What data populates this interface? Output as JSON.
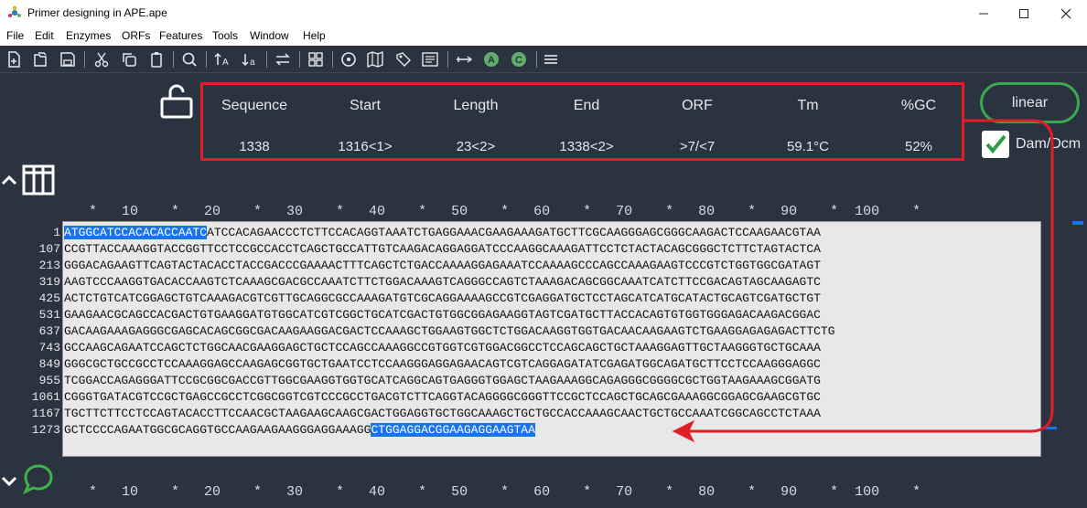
{
  "window": {
    "title": "Primer designing in APE.ape",
    "minimize": "–",
    "maximize": "☐",
    "close": "✕"
  },
  "menu": [
    "File",
    "Edit",
    "Enzymes",
    "ORFs",
    "Features",
    "Tools",
    "Window",
    "Help"
  ],
  "toolbar_icons": [
    "new-file-icon",
    "open-folder-icon",
    "save-icon",
    "cut-icon",
    "copy-icon",
    "paste-icon",
    "search-icon",
    "uppercase-icon",
    "lowercase-icon",
    "reverse-complement-icon",
    "grid-icon",
    "circle-target-icon",
    "map-icon",
    "tag-icon",
    "text-list-icon",
    "primer-icon",
    "enzyme-a-icon",
    "enzyme-c-icon",
    "menu-lines-icon"
  ],
  "info": {
    "columns": [
      {
        "label": "Sequence",
        "value": "1338"
      },
      {
        "label": "Start",
        "value": "1316<1>"
      },
      {
        "label": "Length",
        "value": "23<2>"
      },
      {
        "label": "End",
        "value": "1338<2>"
      },
      {
        "label": "ORF",
        "value": ">7/<7"
      },
      {
        "label": "Tm",
        "value": "59.1°C"
      },
      {
        "label": "%GC",
        "value": "52%"
      }
    ],
    "topology": "linear",
    "dam_dcm": "Dam/Dcm"
  },
  "ruler": "   *   10    *   20    *   30    *   40    *   50    *   60    *   70    *   80    *   90    *  100    *",
  "sequence": {
    "rows": [
      {
        "num": "1",
        "pre": "",
        "hl": "ATGGCATCCACACACCAATC",
        "post": "ATCCACAGAACCCTCTTCCACAGGTAAATCTGAGGAAACGAAGAAAGATGCTTCGCAAGGGAGCGGGCAAGACTCCAAGAACGTAA"
      },
      {
        "num": "107",
        "pre": "CCGTTACCAAAGGTACCGGTTCCTCCGCCACCTCAGCTGCCATTGTCAAGACAGGAGGATCCCAAGGCAAAGATTCCTCTACTACAGCGGGCTCTTCTAGTACTCA",
        "hl": "",
        "post": ""
      },
      {
        "num": "213",
        "pre": "GGGACAGAAGTTCAGTACTACACCTACCGACCCGAAAACTTTCAGCTCTGACCAAAAGGAGAAATCCAAAAGCCCAGCCAAAGAAGTCCCGTCTGGTGGCGATAGT",
        "hl": "",
        "post": ""
      },
      {
        "num": "319",
        "pre": "AAGTCCCAAGGTGACACCAAGTCTCAAAGCGACGCCAAATCTTCTGGACAAAGTCAGGGCCAGTCTAAAGACAGCGGCAAATCATCTTCCGACAGTAGCAAGAGTC",
        "hl": "",
        "post": ""
      },
      {
        "num": "425",
        "pre": "ACTCTGTCATCGGAGCTGTCAAAGACGTCGTTGCAGGCGCCAAAGATGTCGCAGGAAAAGCCGTCGAGGATGCTCCTAGCATCATGCATACTGCAGTCGATGCTGT",
        "hl": "",
        "post": ""
      },
      {
        "num": "531",
        "pre": "GAAGAACGCAGCCACGACTGTGAAGGATGTGGCATCGTCGGCTGCATCGACTGTGGCGGAGAAGGTAGTCGATGCTTACCACAGTGTGGTGGGAGACAAGACGGAC",
        "hl": "",
        "post": ""
      },
      {
        "num": "637",
        "pre": "GACAAGAAAGAGGGCGAGCACAGCGGCGACAAGAAGGACGACTCCAAAGCTGGAAGTGGCTCTGGACAAGGTGGTGACAACAAGAAGTCTGAAGGAGAGAGACTTCTG",
        "hl": "",
        "post": ""
      },
      {
        "num": "743",
        "pre": "GCCAAGCAGAATCCAGCTCTGGCAACGAAGGAGCTGCTCCAGCCAAAGGCCGTGGTCGTGGACGGCCTCCAGCAGCTGCTAAAGGAGTTGCTAAGGGTGCTGCAAA",
        "hl": "",
        "post": ""
      },
      {
        "num": "849",
        "pre": "GGGCGCTGCCGCCTCCAAAGGAGCCAAGAGCGGTGCTGAATCCTCCAAGGGAGGAGAACAGTCGTCAGGAGATATCGAGATGGCAGATGCTTCCTCCAAGGGAGGC",
        "hl": "",
        "post": ""
      },
      {
        "num": "955",
        "pre": "TCGGACCAGAGGGATTCCGCGGCGACCGTTGGCGAAGGTGGTGCATCAGGCAGTGAGGGTGGAGCTAAGAAAGGCAGAGGGCGGGGCGCTGGTAAGAAAGCGGATG",
        "hl": "",
        "post": ""
      },
      {
        "num": "1061",
        "pre": "CGGGTGATACGTCCGCTGAGCCGCCTCGGCGGTCGTCCCGCCTGACGTCTTCAGGTACAGGGGCGGGTTCCGCTCCAGCTGCAGCGAAAGGCGGAGCGAAGCGTGC",
        "hl": "",
        "post": ""
      },
      {
        "num": "1167",
        "pre": "TGCTTCTTCCTCCAGTACACCTTCCAACGCTAAGAAGCAAGCGACTGGAGGTGCTGGCAAAGCTGCTGCCACCAAAGCAACTGCTGCCAAATCGGCAGCCTCTAAA",
        "hl": "",
        "post": ""
      },
      {
        "num": "1273",
        "pre": "GCTCCCCAGAATGGCGCAGGTGCCAAGAAGAAGGGAGGAAAGG",
        "hl": "CTGGAGGACGGAAGAGGAAGTAA",
        "post": ""
      }
    ]
  },
  "colors": {
    "background": "#2b3340",
    "highlight_box": "#e01e26",
    "linear_border": "#39a94f",
    "selection": "#1a73e8"
  }
}
